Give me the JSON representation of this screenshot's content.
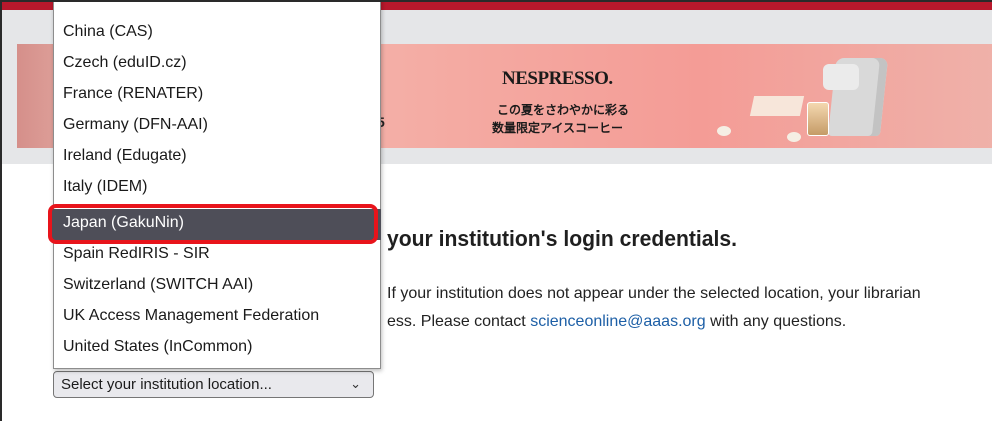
{
  "ad": {
    "partial_text": "5",
    "brand": "NESPRESSO.",
    "line1": "この夏をさわやかに彩る",
    "line2": "数量限定アイスコーヒー"
  },
  "main": {
    "heading_partial": "your institution's login credentials.",
    "para_line1": "If your institution does not appear under the selected location, your librarian",
    "para_line2_prefix": "ess. Please contact ",
    "contact_email": "scienceonline@aaas.org",
    "para_line2_suffix": " with any questions."
  },
  "dropdown": {
    "cut_top_option": "China (CAS)",
    "options": [
      "China (CAS)",
      "Czech (eduID.cz)",
      "France (RENATER)",
      "Germany (DFN-AAI)",
      "Ireland (Edugate)",
      "Italy (IDEM)",
      "Japan (GakuNin)",
      "Spain RedIRIS - SIR",
      "Switzerland (SWITCH AAI)",
      "UK Access Management Federation",
      "United States (InCommon)"
    ],
    "highlighted_option": "Japan (GakuNin)"
  },
  "select": {
    "value": "Select your institution location...",
    "chevron_icon": "chevron-down-icon"
  },
  "colors": {
    "brand_red": "#b8182c",
    "link": "#1d5fa6",
    "highlight_ring": "#e8141b",
    "selected_option_bg": "#4e4e58"
  }
}
